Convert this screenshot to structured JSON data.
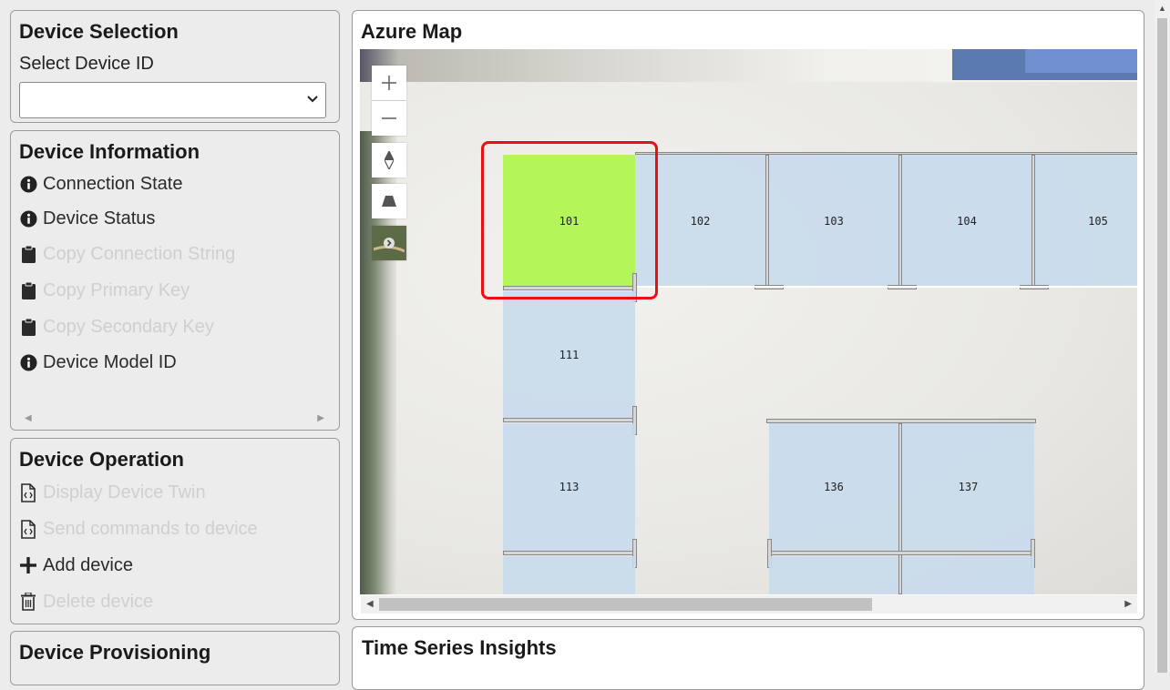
{
  "device_selection": {
    "title": "Device Selection",
    "select_label": "Select Device ID",
    "select_value": ""
  },
  "device_information": {
    "title": "Device Information",
    "items": [
      {
        "label": "Connection State",
        "icon": "info-circle-icon",
        "enabled": true
      },
      {
        "label": "Device Status",
        "icon": "info-circle-icon",
        "enabled": true
      },
      {
        "label": "Copy Connection String",
        "icon": "clipboard-icon",
        "enabled": false
      },
      {
        "label": "Copy Primary Key",
        "icon": "clipboard-icon",
        "enabled": false
      },
      {
        "label": "Copy Secondary Key",
        "icon": "clipboard-icon",
        "enabled": false
      },
      {
        "label": "Device Model ID",
        "icon": "info-circle-icon",
        "enabled": true
      }
    ]
  },
  "device_operation": {
    "title": "Device Operation",
    "items": [
      {
        "label": "Display Device Twin",
        "icon": "code-file-icon",
        "enabled": false
      },
      {
        "label": "Send commands to device",
        "icon": "code-file-icon",
        "enabled": false
      },
      {
        "label": "Add device",
        "icon": "plus-icon",
        "enabled": true
      },
      {
        "label": "Delete device",
        "icon": "trash-icon",
        "enabled": false
      }
    ]
  },
  "device_provisioning": {
    "title": "Device Provisioning"
  },
  "azure_map": {
    "title": "Azure Map",
    "selected_room": "101",
    "rooms": [
      "101",
      "102",
      "103",
      "104",
      "105",
      "111",
      "113",
      "136",
      "137"
    ],
    "controls": [
      "zoom-in",
      "zoom-out",
      "compass",
      "pitch",
      "style-picker"
    ]
  },
  "time_series": {
    "title": "Time Series Insights"
  },
  "colors": {
    "selected_room": "#b4f55a",
    "room": "#c8daec",
    "highlight": "#e81010"
  }
}
